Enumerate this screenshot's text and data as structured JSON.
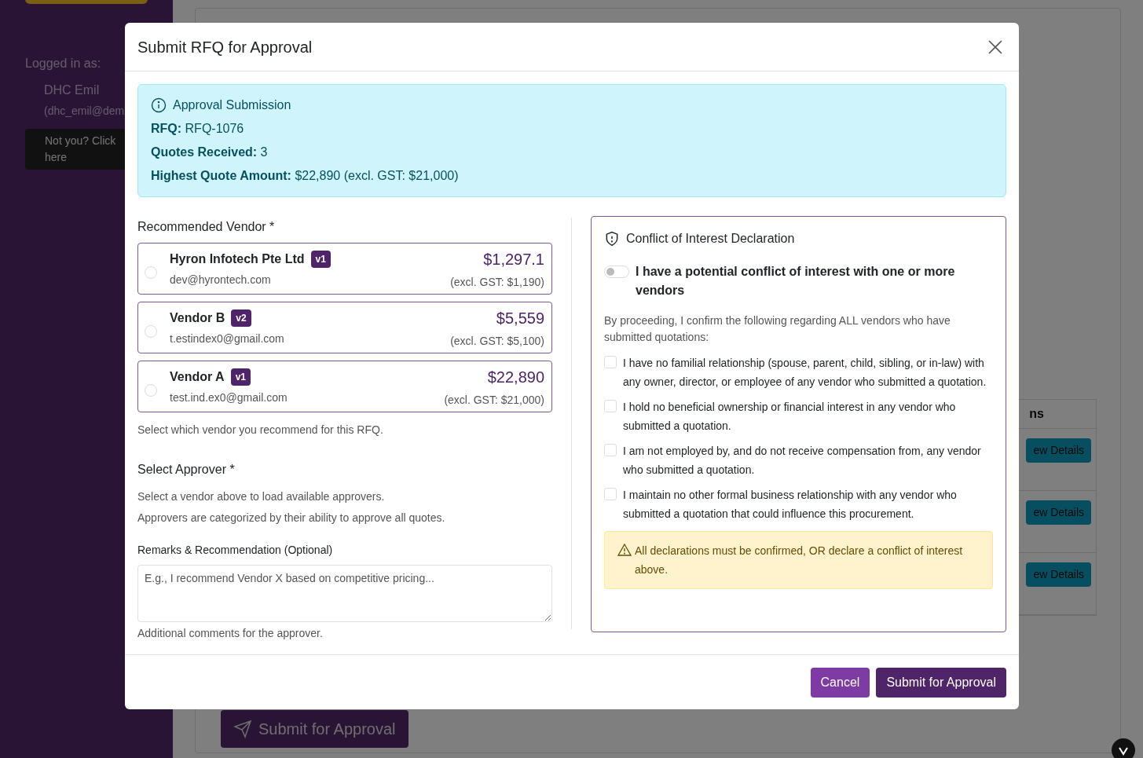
{
  "sidebar": {
    "logged_in_label": "Logged in as:",
    "user_name": "DHC Emil",
    "user_email": "(dhc_emil@dem",
    "switch_user_button": "Not you? Click here"
  },
  "background": {
    "table_header": "ns",
    "row_buttons": [
      "ew Details",
      "ew Details",
      "ew Details"
    ],
    "submit_button": "Submit for Approval"
  },
  "modal": {
    "title": "Submit RFQ for Approval",
    "info": {
      "title": "Approval Submission",
      "lines": [
        "**RFQ:** RFQ-1076",
        "**Quotes Received:** 3",
        "**Highest Quote Amount:** $22,890 (excl. GST: $21,000)"
      ]
    },
    "vendor_section": {
      "label": "Recommended Vendor *",
      "vendors": [
        {
          "name": "Hyron Infotech Pte Ltd",
          "version": "v1",
          "email": "dev@hyrontech.com",
          "amount": "$1,297.1",
          "excl": "(excl. GST: $1,190)",
          "selected": false
        },
        {
          "name": "Vendor B",
          "version": "v2",
          "email": "t.estindex0@gmail.com",
          "amount": "$5,559",
          "excl": "(excl. GST: $5,100)",
          "selected": false
        },
        {
          "name": "Vendor A",
          "version": "v1",
          "email": "test.ind.ex0@gmail.com",
          "amount": "$22,890",
          "excl": "(excl. GST: $21,000)",
          "selected": false
        }
      ],
      "help": "Select which vendor you recommend for this RFQ."
    },
    "approver": {
      "label": "Select Approver *",
      "lines": [
        "Select a vendor above to load available approvers.",
        "Approvers are categorized by their ability to approve all quotes."
      ]
    },
    "remarks": {
      "label": "Remarks & Recommendation (Optional)",
      "placeholder": "E.g., I recommend Vendor X based on competitive pricing...",
      "help": "Additional comments for the approver."
    },
    "conflict": {
      "title": "Conflict of Interest Declaration",
      "toggle": {
        "label": "I have a potential conflict of interest with one or more vendors",
        "on": false
      },
      "intro": "By proceeding, I confirm the following regarding ALL vendors who have submitted quotations:",
      "declarations": [
        {
          "text": "I have no familial relationship (spouse, parent, child, sibling, or in-law) with any owner, director, or employee of any vendor who submitted a quotation.",
          "checked": false
        },
        {
          "text": "I hold no beneficial ownership or financial interest in any vendor who submitted a quotation.",
          "checked": false
        },
        {
          "text": "I am not employed by, and do not receive compensation from, any vendor who submitted a quotation.",
          "checked": false
        },
        {
          "text": "I maintain no other formal business relationship with any vendor who submitted a quotation that could influence this procurement.",
          "checked": false
        }
      ],
      "warning": "All declarations must be confirmed, OR declare a conflict of interest above."
    },
    "buttons": {
      "cancel": "Cancel",
      "submit": "Submit for Approval"
    }
  }
}
